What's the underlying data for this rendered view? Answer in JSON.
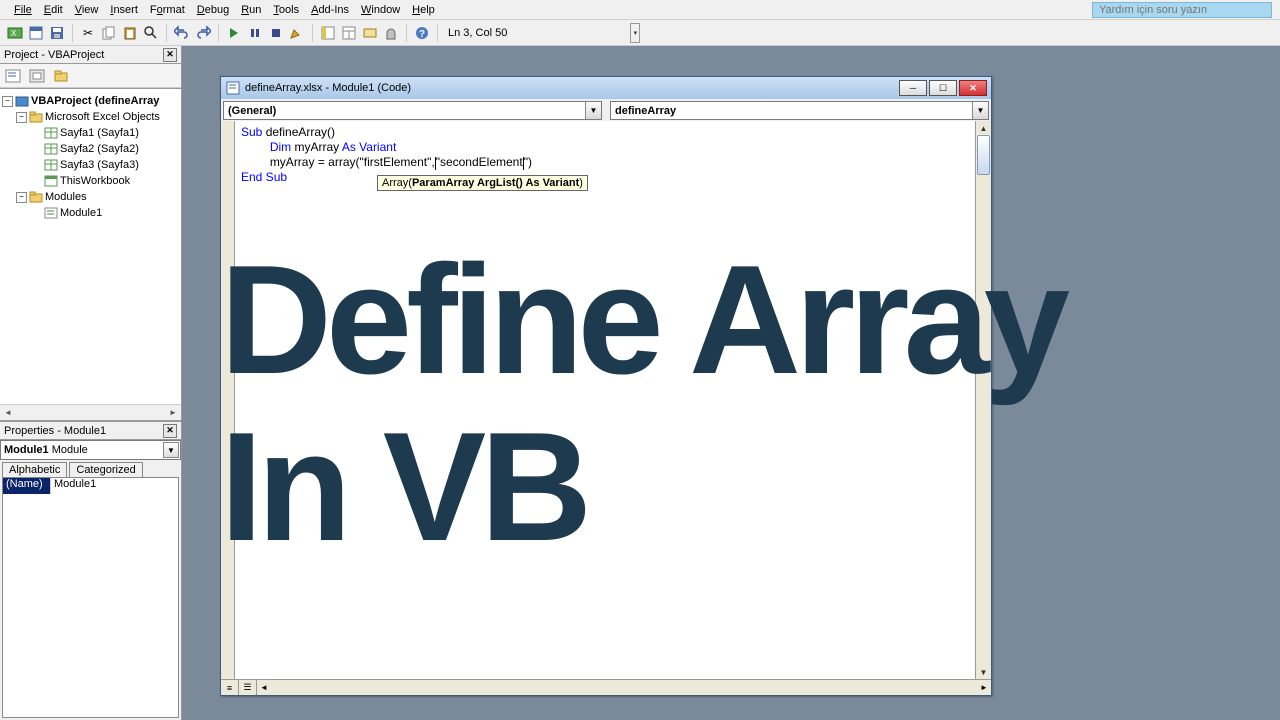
{
  "menu": {
    "items": [
      "File",
      "Edit",
      "View",
      "Insert",
      "Format",
      "Debug",
      "Run",
      "Tools",
      "Add-Ins",
      "Window",
      "Help"
    ]
  },
  "helpInput": {
    "placeholder": "Yardım için soru yazın"
  },
  "statusBar": {
    "position": "Ln 3, Col 50"
  },
  "projectPanel": {
    "title": "Project - VBAProject",
    "tree": {
      "root": "VBAProject (defineArray",
      "folder1": "Microsoft Excel Objects",
      "sheets": [
        "Sayfa1 (Sayfa1)",
        "Sayfa2 (Sayfa2)",
        "Sayfa3 (Sayfa3)",
        "ThisWorkbook"
      ],
      "folder2": "Modules",
      "modules": [
        "Module1"
      ]
    }
  },
  "propertiesPanel": {
    "title": "Properties - Module1",
    "selector": {
      "name": "Module1",
      "type": "Module"
    },
    "tabs": [
      "Alphabetic",
      "Categorized"
    ],
    "rows": [
      {
        "name": "(Name)",
        "value": "Module1"
      }
    ]
  },
  "codeWindow": {
    "title": "defineArray.xlsx - Module1 (Code)",
    "object": "(General)",
    "procedure": "defineArray",
    "code": {
      "l1": {
        "kw1": "Sub",
        "rest": " defineArray()"
      },
      "l2": {
        "kw1": "Dim",
        "mid": " myArray ",
        "kw2": "As Variant"
      },
      "l3": {
        "pre": "myArray = array(\"firstElement\",",
        "cursor": "",
        "post": "\"secondElement",
        "tail": "\")"
      },
      "l4": {
        "kw": "End Sub"
      }
    },
    "tooltip": {
      "pre": "Array(",
      "bold": "ParamArray ArgList() As Variant",
      "post": ")"
    }
  },
  "overlay": {
    "line1": "Define Array",
    "line2": "In VB"
  }
}
